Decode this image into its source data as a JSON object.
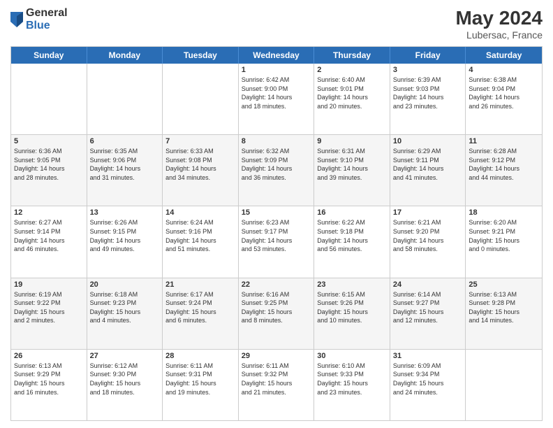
{
  "header": {
    "logo_general": "General",
    "logo_blue": "Blue",
    "month_year": "May 2024",
    "location": "Lubersac, France"
  },
  "weekdays": [
    "Sunday",
    "Monday",
    "Tuesday",
    "Wednesday",
    "Thursday",
    "Friday",
    "Saturday"
  ],
  "rows": [
    [
      {
        "day": "",
        "lines": []
      },
      {
        "day": "",
        "lines": []
      },
      {
        "day": "",
        "lines": []
      },
      {
        "day": "1",
        "lines": [
          "Sunrise: 6:42 AM",
          "Sunset: 9:00 PM",
          "Daylight: 14 hours",
          "and 18 minutes."
        ]
      },
      {
        "day": "2",
        "lines": [
          "Sunrise: 6:40 AM",
          "Sunset: 9:01 PM",
          "Daylight: 14 hours",
          "and 20 minutes."
        ]
      },
      {
        "day": "3",
        "lines": [
          "Sunrise: 6:39 AM",
          "Sunset: 9:03 PM",
          "Daylight: 14 hours",
          "and 23 minutes."
        ]
      },
      {
        "day": "4",
        "lines": [
          "Sunrise: 6:38 AM",
          "Sunset: 9:04 PM",
          "Daylight: 14 hours",
          "and 26 minutes."
        ]
      }
    ],
    [
      {
        "day": "5",
        "lines": [
          "Sunrise: 6:36 AM",
          "Sunset: 9:05 PM",
          "Daylight: 14 hours",
          "and 28 minutes."
        ]
      },
      {
        "day": "6",
        "lines": [
          "Sunrise: 6:35 AM",
          "Sunset: 9:06 PM",
          "Daylight: 14 hours",
          "and 31 minutes."
        ]
      },
      {
        "day": "7",
        "lines": [
          "Sunrise: 6:33 AM",
          "Sunset: 9:08 PM",
          "Daylight: 14 hours",
          "and 34 minutes."
        ]
      },
      {
        "day": "8",
        "lines": [
          "Sunrise: 6:32 AM",
          "Sunset: 9:09 PM",
          "Daylight: 14 hours",
          "and 36 minutes."
        ]
      },
      {
        "day": "9",
        "lines": [
          "Sunrise: 6:31 AM",
          "Sunset: 9:10 PM",
          "Daylight: 14 hours",
          "and 39 minutes."
        ]
      },
      {
        "day": "10",
        "lines": [
          "Sunrise: 6:29 AM",
          "Sunset: 9:11 PM",
          "Daylight: 14 hours",
          "and 41 minutes."
        ]
      },
      {
        "day": "11",
        "lines": [
          "Sunrise: 6:28 AM",
          "Sunset: 9:12 PM",
          "Daylight: 14 hours",
          "and 44 minutes."
        ]
      }
    ],
    [
      {
        "day": "12",
        "lines": [
          "Sunrise: 6:27 AM",
          "Sunset: 9:14 PM",
          "Daylight: 14 hours",
          "and 46 minutes."
        ]
      },
      {
        "day": "13",
        "lines": [
          "Sunrise: 6:26 AM",
          "Sunset: 9:15 PM",
          "Daylight: 14 hours",
          "and 49 minutes."
        ]
      },
      {
        "day": "14",
        "lines": [
          "Sunrise: 6:24 AM",
          "Sunset: 9:16 PM",
          "Daylight: 14 hours",
          "and 51 minutes."
        ]
      },
      {
        "day": "15",
        "lines": [
          "Sunrise: 6:23 AM",
          "Sunset: 9:17 PM",
          "Daylight: 14 hours",
          "and 53 minutes."
        ]
      },
      {
        "day": "16",
        "lines": [
          "Sunrise: 6:22 AM",
          "Sunset: 9:18 PM",
          "Daylight: 14 hours",
          "and 56 minutes."
        ]
      },
      {
        "day": "17",
        "lines": [
          "Sunrise: 6:21 AM",
          "Sunset: 9:20 PM",
          "Daylight: 14 hours",
          "and 58 minutes."
        ]
      },
      {
        "day": "18",
        "lines": [
          "Sunrise: 6:20 AM",
          "Sunset: 9:21 PM",
          "Daylight: 15 hours",
          "and 0 minutes."
        ]
      }
    ],
    [
      {
        "day": "19",
        "lines": [
          "Sunrise: 6:19 AM",
          "Sunset: 9:22 PM",
          "Daylight: 15 hours",
          "and 2 minutes."
        ]
      },
      {
        "day": "20",
        "lines": [
          "Sunrise: 6:18 AM",
          "Sunset: 9:23 PM",
          "Daylight: 15 hours",
          "and 4 minutes."
        ]
      },
      {
        "day": "21",
        "lines": [
          "Sunrise: 6:17 AM",
          "Sunset: 9:24 PM",
          "Daylight: 15 hours",
          "and 6 minutes."
        ]
      },
      {
        "day": "22",
        "lines": [
          "Sunrise: 6:16 AM",
          "Sunset: 9:25 PM",
          "Daylight: 15 hours",
          "and 8 minutes."
        ]
      },
      {
        "day": "23",
        "lines": [
          "Sunrise: 6:15 AM",
          "Sunset: 9:26 PM",
          "Daylight: 15 hours",
          "and 10 minutes."
        ]
      },
      {
        "day": "24",
        "lines": [
          "Sunrise: 6:14 AM",
          "Sunset: 9:27 PM",
          "Daylight: 15 hours",
          "and 12 minutes."
        ]
      },
      {
        "day": "25",
        "lines": [
          "Sunrise: 6:13 AM",
          "Sunset: 9:28 PM",
          "Daylight: 15 hours",
          "and 14 minutes."
        ]
      }
    ],
    [
      {
        "day": "26",
        "lines": [
          "Sunrise: 6:13 AM",
          "Sunset: 9:29 PM",
          "Daylight: 15 hours",
          "and 16 minutes."
        ]
      },
      {
        "day": "27",
        "lines": [
          "Sunrise: 6:12 AM",
          "Sunset: 9:30 PM",
          "Daylight: 15 hours",
          "and 18 minutes."
        ]
      },
      {
        "day": "28",
        "lines": [
          "Sunrise: 6:11 AM",
          "Sunset: 9:31 PM",
          "Daylight: 15 hours",
          "and 19 minutes."
        ]
      },
      {
        "day": "29",
        "lines": [
          "Sunrise: 6:11 AM",
          "Sunset: 9:32 PM",
          "Daylight: 15 hours",
          "and 21 minutes."
        ]
      },
      {
        "day": "30",
        "lines": [
          "Sunrise: 6:10 AM",
          "Sunset: 9:33 PM",
          "Daylight: 15 hours",
          "and 23 minutes."
        ]
      },
      {
        "day": "31",
        "lines": [
          "Sunrise: 6:09 AM",
          "Sunset: 9:34 PM",
          "Daylight: 15 hours",
          "and 24 minutes."
        ]
      },
      {
        "day": "",
        "lines": []
      }
    ]
  ]
}
